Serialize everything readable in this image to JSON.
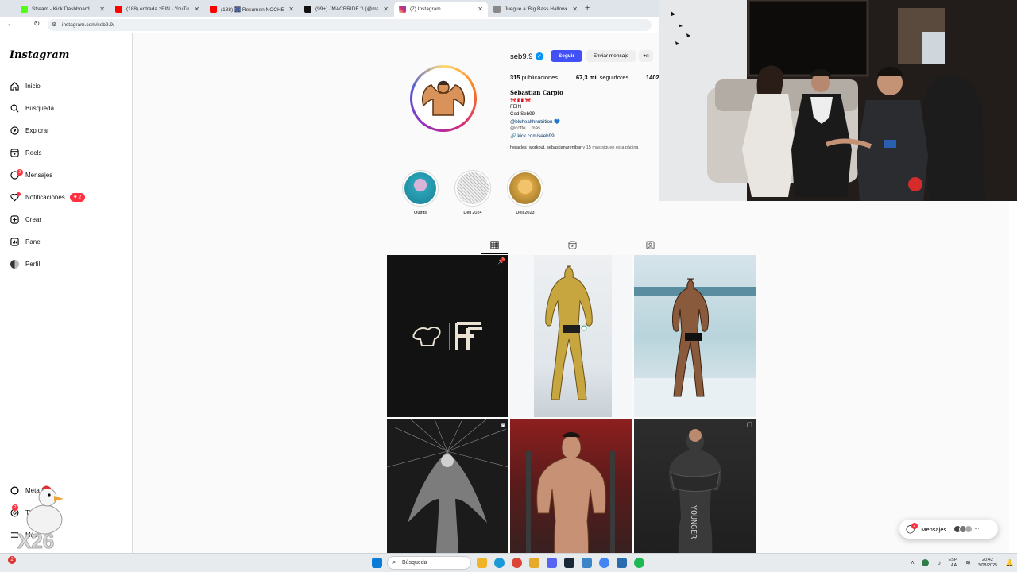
{
  "browser": {
    "tabs": [
      {
        "label": "Stream - Kick Dashboard",
        "color": "#53fc18"
      },
      {
        "label": "(188) entrada zEIN - YouTube",
        "color": "#ff0000"
      },
      {
        "label": "(188) 🎆 Resumen NOCHE DO...",
        "color": "#ff0000"
      },
      {
        "label": "(99+) JMACBRIDE \"\\ (@macbr...",
        "color": "#111111"
      },
      {
        "label": "(7) Instagram",
        "color": "#d62976"
      },
      {
        "label": "Juegue a 'Big Bass Halloween 3'...",
        "color": "#777777"
      }
    ],
    "url": "instagram.com/seb9.9/"
  },
  "sidebar": {
    "logo": "Instagram",
    "items": [
      {
        "label": "Inicio",
        "icon": "home-icon"
      },
      {
        "label": "Búsqueda",
        "icon": "search-icon"
      },
      {
        "label": "Explorar",
        "icon": "compass-icon"
      },
      {
        "label": "Reels",
        "icon": "reels-icon"
      },
      {
        "label": "Mensajes",
        "icon": "messenger-icon",
        "badge": "2"
      },
      {
        "label": "Notificaciones",
        "icon": "heart-icon",
        "pill": "2"
      },
      {
        "label": "Crear",
        "icon": "plus-icon"
      },
      {
        "label": "Panel",
        "icon": "dashboard-icon"
      },
      {
        "label": "Perfil",
        "icon": "avatar-icon"
      }
    ],
    "bottom": [
      {
        "label": "Meta AI",
        "icon": "meta-icon"
      },
      {
        "label": "Threads",
        "icon": "threads-icon",
        "badge": "2"
      },
      {
        "label": "Más",
        "icon": "menu-icon"
      }
    ],
    "overlay_text": "X26"
  },
  "profile": {
    "username": "seb9.9",
    "follow_label": "Seguir",
    "message_label": "Enviar mensaje",
    "add_label": "+ᴙ",
    "posts_count": "315",
    "posts_label": "publicaciones",
    "followers_count": "67,3 mil",
    "followers_label": "seguidores",
    "following_count": "1402",
    "full_name": "Sebastian Carpio",
    "bio": [
      "🎀 🇵🇪 🎀",
      "FEIN",
      "Cod Seb99",
      "@bluhealthnutrition 💙",
      "@coffe... más",
      "🔗 kick.com/seeb99"
    ],
    "followed_by_names": "heracles_workout, sebastianarenibar",
    "followed_by_rest": "y 15 más siguen esta página"
  },
  "highlights": [
    {
      "label": "Outfits",
      "color": "#2aa3b8"
    },
    {
      "label": "Dell 2024",
      "color": "#bbbbbb"
    },
    {
      "label": "Dell 2023",
      "color": "#e8b84a"
    }
  ],
  "posts": [
    {
      "name": "post-logo",
      "bg": "#121212",
      "mark": "📌"
    },
    {
      "name": "post-stage-gold",
      "bg": "#c4a44a",
      "mark": ""
    },
    {
      "name": "post-stage-tan",
      "bg": "#8c6a50",
      "mark": ""
    },
    {
      "name": "post-angel",
      "bg": "#2d2d2d",
      "mark": "◙"
    },
    {
      "name": "post-gym",
      "bg": "#7c3a2e",
      "mark": ""
    },
    {
      "name": "post-dark",
      "bg": "#1f1f1f",
      "mark": "❐"
    }
  ],
  "messages_pill": {
    "label": "Mensajes",
    "badge": "2"
  },
  "taskbar": {
    "search_placeholder": "Búsqueda",
    "lang": "ESP",
    "lang2": "LAA",
    "time": "20:42",
    "date": "3/08/2025"
  }
}
